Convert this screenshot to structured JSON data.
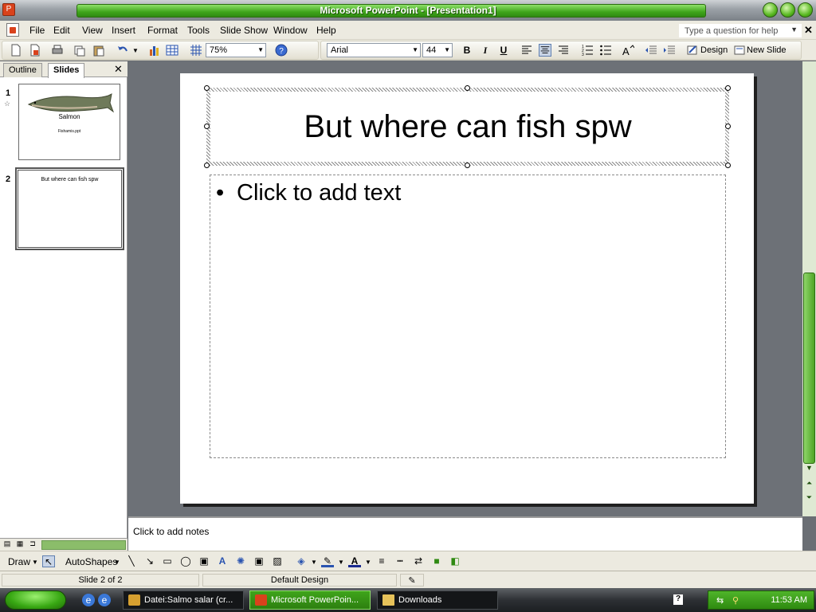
{
  "window": {
    "title": "Microsoft PowerPoint - [Presentation1]"
  },
  "menu": {
    "items": [
      "File",
      "Edit",
      "View",
      "Insert",
      "Format",
      "Tools",
      "Slide Show",
      "Window",
      "Help"
    ],
    "help_placeholder": "Type a question for help"
  },
  "toolbar": {
    "zoom": "75%",
    "font": "Arial",
    "font_size": "44",
    "bold": "B",
    "italic": "I",
    "underline": "U",
    "design_label": "Design",
    "new_slide_label": "New Slide"
  },
  "left_pane": {
    "tabs": [
      "Outline",
      "Slides"
    ],
    "active_tab": "Slides",
    "slides": [
      {
        "number": "1",
        "title": "Salmon",
        "subtitle": "Fishamis.ppt"
      },
      {
        "number": "2",
        "title": "But where can fish spw",
        "subtitle": ""
      }
    ]
  },
  "slide": {
    "title": "But where can fish spw",
    "body_placeholder": "Click to add text",
    "bullet": "•"
  },
  "notes": {
    "placeholder": "Click to add notes"
  },
  "drawing_toolbar": {
    "draw_label": "Draw",
    "autoshapes_label": "AutoShapes"
  },
  "status": {
    "slide": "Slide 2 of 2",
    "design": "Default Design"
  },
  "taskbar": {
    "buttons": [
      {
        "label": "Datei:Salmo salar (cr...",
        "active": false
      },
      {
        "label": "Microsoft PowerPoin...",
        "active": true
      },
      {
        "label": "Downloads",
        "active": false
      }
    ],
    "clock": "11:53 AM"
  },
  "colors": {
    "accent_green": "#3fa51b",
    "slide_bg": "#ffffff",
    "workspace": "#6d7177"
  }
}
